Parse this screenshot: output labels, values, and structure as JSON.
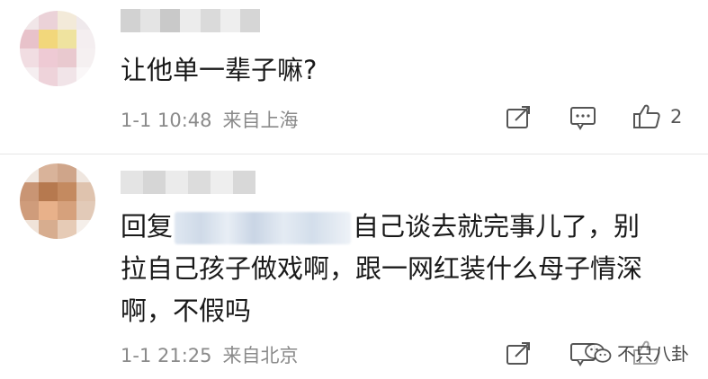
{
  "comments": [
    {
      "text": "让他单一辈子嘛?",
      "date": "1-1 10:48",
      "location": "来自上海",
      "likes": "2"
    },
    {
      "reply_prefix": "回复",
      "text_line1_rest": "自己谈去就完事儿了，别",
      "text_line2": "拉自己孩子做戏啊，跟一网红装什么母子情深",
      "text_line3": "啊，不假吗",
      "date": "1-1 21:25",
      "location": "来自北京"
    }
  ],
  "watermark": {
    "text": "不只八卦"
  },
  "icons": [
    "share-icon",
    "comment-icon",
    "like-icon",
    "wechat-icon"
  ],
  "colors": {
    "text": "#1a1a1a",
    "meta": "#8a8a8a",
    "icon": "#555555"
  }
}
